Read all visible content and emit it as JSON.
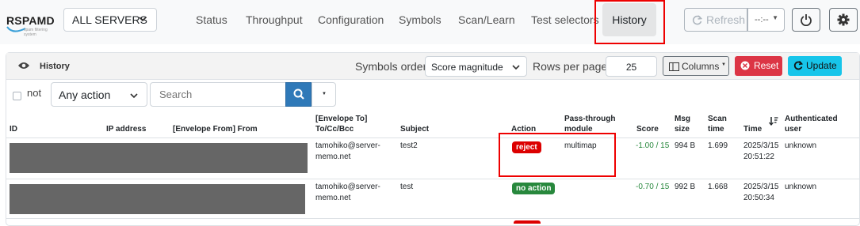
{
  "brand": {
    "logo_text": "RSPAMD",
    "logo_subtitle": "spam filtering system"
  },
  "navbar": {
    "server_select": "ALL SERVERS",
    "tabs": [
      {
        "label": "Status"
      },
      {
        "label": "Throughput"
      },
      {
        "label": "Configuration"
      },
      {
        "label": "Symbols"
      },
      {
        "label": "Scan/Learn"
      },
      {
        "label": "Test selectors"
      },
      {
        "label": "History",
        "active": true
      }
    ],
    "refresh_label": "Refresh",
    "interval_label": "--:--",
    "icons": {
      "refresh": "refresh-icon",
      "power": "power-icon",
      "settings": "gear-icon"
    }
  },
  "history": {
    "title": "History",
    "symbols_order_label": "Symbols order:",
    "symbols_order_value": "Score magnitude",
    "rows_per_page_label": "Rows per page:",
    "rows_per_page_value": "25",
    "columns_label": "Columns",
    "reset_label": "Reset",
    "update_label": "Update",
    "filter": {
      "not_label": "not",
      "action_value": "Any action",
      "search_placeholder": "Search"
    },
    "columns": {
      "id": "ID",
      "ip": "IP address",
      "env_from": "[Envelope From] From",
      "env_to_1": "[Envelope To]",
      "env_to_2": "To/Cc/Bcc",
      "subject": "Subject",
      "action": "Action",
      "pass_1": "Pass-through",
      "pass_2": "module",
      "score": "Score",
      "msg_1": "Msg",
      "msg_2": "size",
      "scan_1": "Scan",
      "scan_2": "time",
      "time": "Time",
      "user_1": "Authenticated",
      "user_2": "user"
    },
    "rows": [
      {
        "to_1": "tamohiko@server-",
        "to_2": "memo.net",
        "subject": "test2",
        "action": "reject",
        "action_color": "#dc0000",
        "pass_through": "multimap",
        "score": "-1.00 / 15",
        "size": "994 B",
        "scan_time": "1.699",
        "time_1": "2025/3/15",
        "time_2": "20:51:22",
        "user": "unknown"
      },
      {
        "to_1": "tamohiko@server-",
        "to_2": "memo.net",
        "subject": "test",
        "action": "no action",
        "action_color": "#28883d",
        "pass_through": "",
        "score": "-0.70 / 15",
        "size": "992 B",
        "scan_time": "1.668",
        "time_1": "2025/3/15",
        "time_2": "20:50:34",
        "user": "unknown"
      }
    ],
    "highlight_color": "#ee0000"
  }
}
